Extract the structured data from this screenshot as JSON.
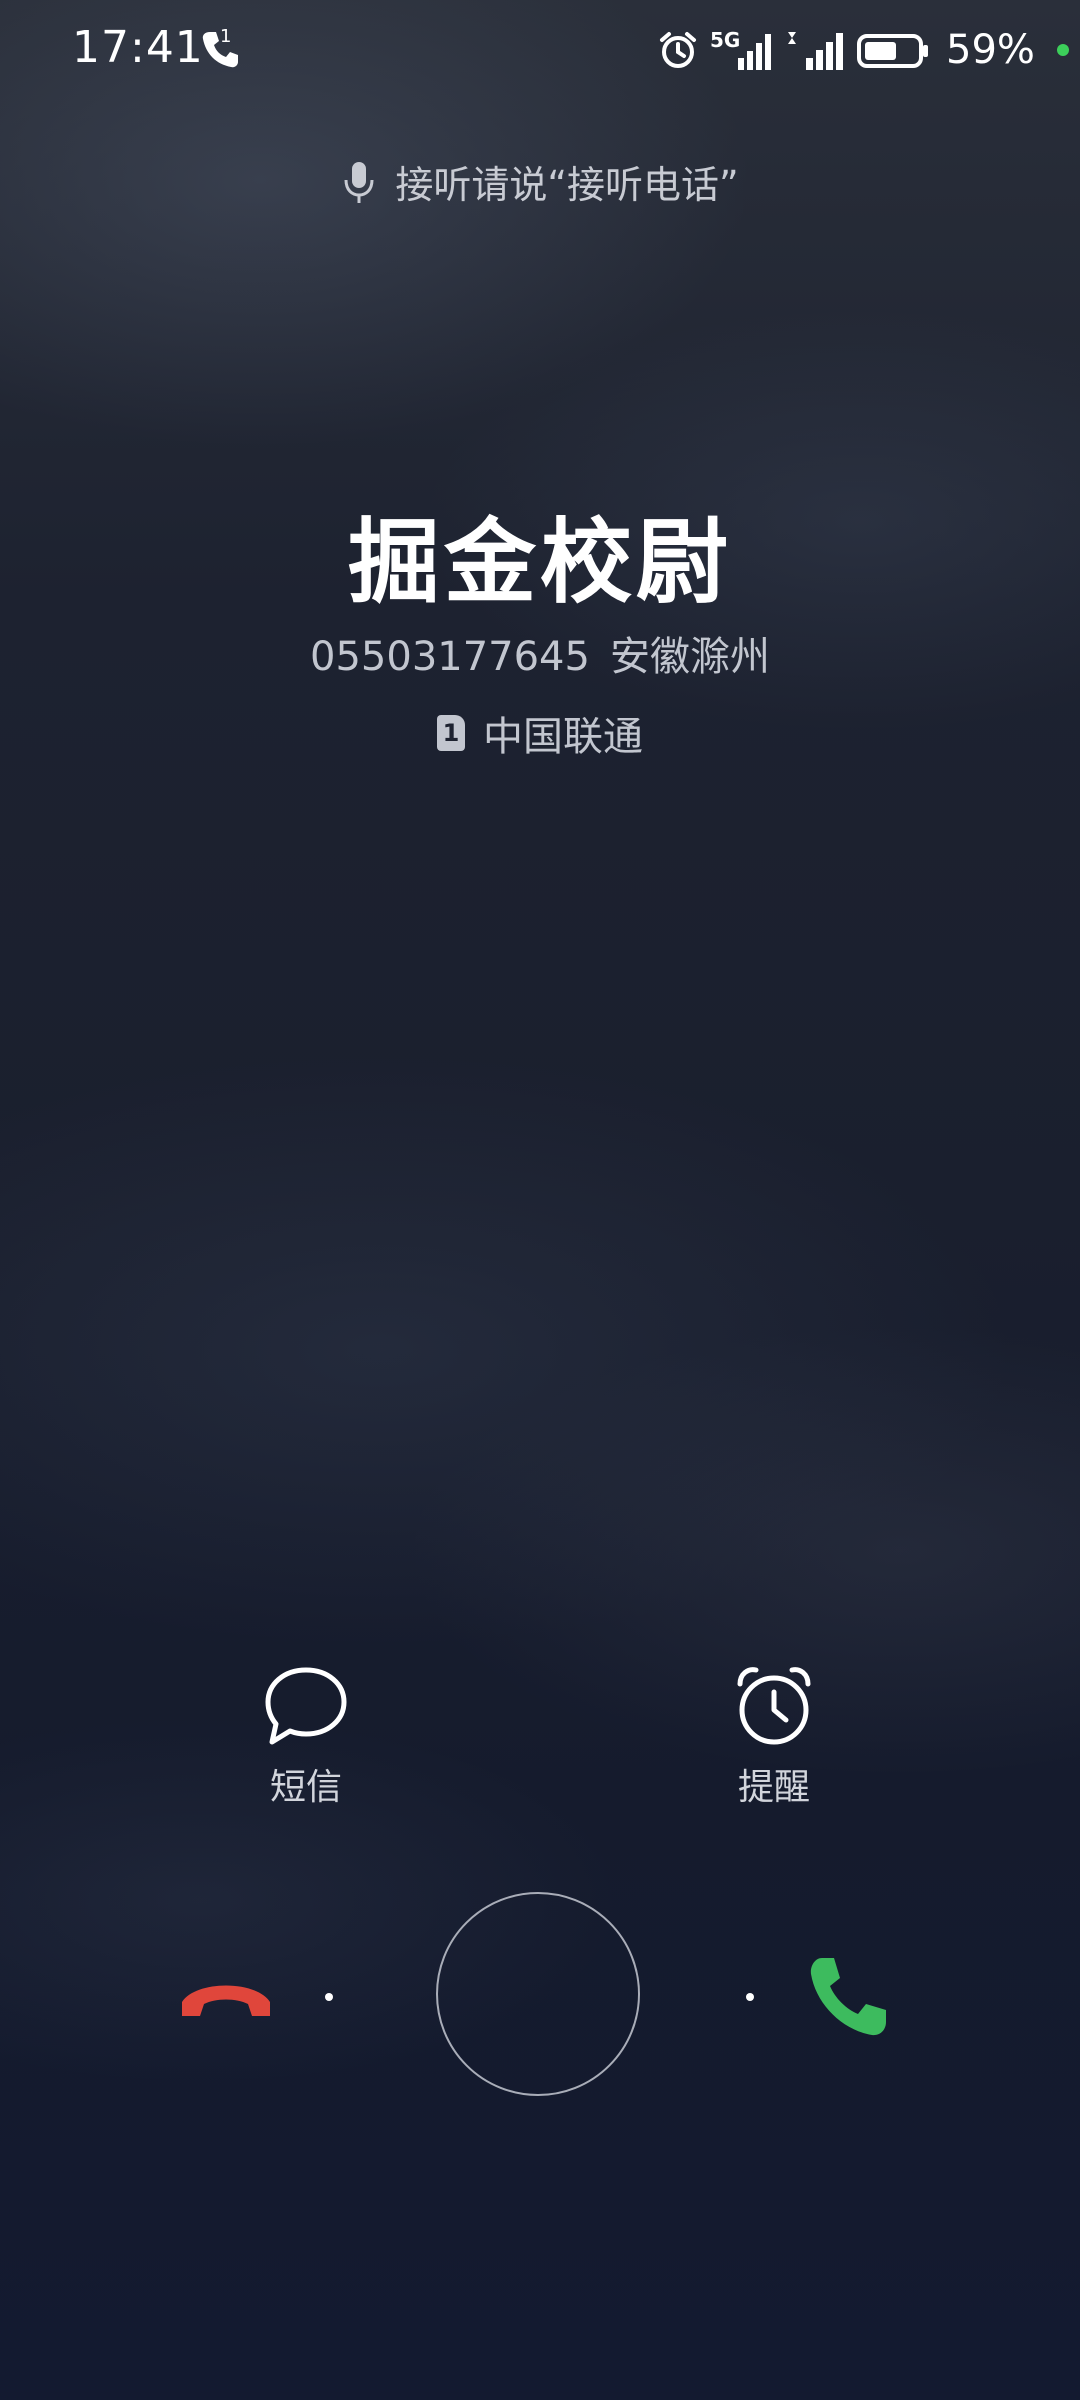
{
  "status_bar": {
    "time": "17:41",
    "call_count": "1",
    "network": "5G",
    "battery_text": "59%",
    "icons": [
      "phone-icon",
      "alarm-icon",
      "signal-5g-icon",
      "signal-icon",
      "battery-icon"
    ],
    "battery_level": 0.59,
    "dot_color": "#3ccf5a"
  },
  "voice_hint": {
    "text": "接听请说“接听电话”",
    "icon": "microphone-icon"
  },
  "caller": {
    "name": "掘金校尉",
    "number": "05503177645",
    "location": "安徽滁州",
    "sim_slot": "1",
    "carrier": "中国联通"
  },
  "actions": {
    "sms": {
      "label": "短信",
      "icon": "message-bubble-icon"
    },
    "reminder": {
      "label": "提醒",
      "icon": "alarm-clock-icon"
    }
  },
  "answer_controls": {
    "decline_icon": "hang-up-icon",
    "accept_icon": "phone-accept-icon",
    "decline_color": "#e0463b",
    "accept_color": "#3dbb5e"
  }
}
